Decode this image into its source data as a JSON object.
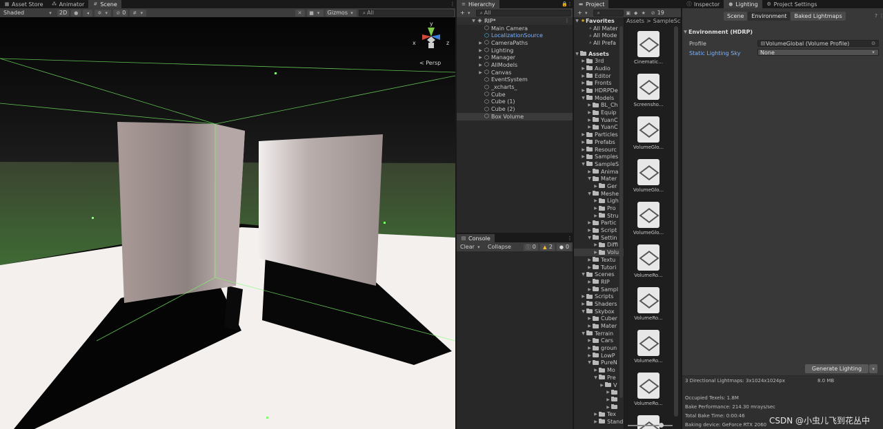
{
  "scene_window": {
    "tabs": [
      {
        "label": "Asset Store",
        "icon": "store-icon"
      },
      {
        "label": "Animator",
        "icon": "animator-icon"
      },
      {
        "label": "Scene",
        "icon": "scene-icon"
      }
    ],
    "shading_mode": "Shaded",
    "mode_2d": "2D",
    "hidden_count": "0",
    "gizmos_label": "Gizmos",
    "search_placeholder": "All",
    "persp_label": "< Persp",
    "axis_labels": {
      "x": "x",
      "y": "y",
      "z": "z"
    }
  },
  "hierarchy": {
    "tab": "Hierarchy",
    "search_placeholder": "All",
    "scene_name": "RIP*",
    "items": [
      {
        "label": "Main Camera",
        "foldable": false
      },
      {
        "label": "LocalizationSource",
        "foldable": false,
        "highlight": true
      },
      {
        "label": "CameraPaths",
        "foldable": true
      },
      {
        "label": "Lighting",
        "foldable": true
      },
      {
        "label": "Manager",
        "foldable": true
      },
      {
        "label": "AllModels",
        "foldable": true
      },
      {
        "label": "Canvas",
        "foldable": true
      },
      {
        "label": "EventSystem",
        "foldable": false
      },
      {
        "label": "_xcharts_",
        "foldable": false
      },
      {
        "label": "Cube",
        "foldable": false
      },
      {
        "label": "Cube (1)",
        "foldable": false
      },
      {
        "label": "Cube (2)",
        "foldable": false
      },
      {
        "label": "Box Volume",
        "foldable": false,
        "selected": true
      }
    ]
  },
  "console": {
    "tab": "Console",
    "clear_label": "Clear",
    "collapse_label": "Collapse",
    "log_count": "0",
    "warning_count": "2",
    "error_count": "0"
  },
  "project": {
    "tab": "Project",
    "hidden_count": "19",
    "favorites_label": "Favorites",
    "favorites": [
      "All Mater",
      "All Mode",
      "All Prefa"
    ],
    "breadcrumb": [
      "Assets",
      "SampleSc"
    ],
    "tree": [
      {
        "label": "Assets",
        "indent": 0,
        "open": true,
        "bold": true
      },
      {
        "label": "3rd",
        "indent": 1
      },
      {
        "label": "Audio",
        "indent": 1
      },
      {
        "label": "Editor",
        "indent": 1
      },
      {
        "label": "Fronts",
        "indent": 1
      },
      {
        "label": "HDRPDe",
        "indent": 1
      },
      {
        "label": "Models",
        "indent": 1,
        "open": true
      },
      {
        "label": "BL_Ch",
        "indent": 2
      },
      {
        "label": "Equip",
        "indent": 2
      },
      {
        "label": "YuanC",
        "indent": 2
      },
      {
        "label": "YuanC",
        "indent": 2
      },
      {
        "label": "Particles",
        "indent": 1
      },
      {
        "label": "Prefabs",
        "indent": 1
      },
      {
        "label": "Resourc",
        "indent": 1
      },
      {
        "label": "Samples",
        "indent": 1
      },
      {
        "label": "SampleS",
        "indent": 1,
        "open": true
      },
      {
        "label": "Anima",
        "indent": 2
      },
      {
        "label": "Mater",
        "indent": 2,
        "open": true
      },
      {
        "label": "Ger",
        "indent": 3
      },
      {
        "label": "Meshe",
        "indent": 2,
        "open": true
      },
      {
        "label": "Ligh",
        "indent": 3
      },
      {
        "label": "Pro",
        "indent": 3
      },
      {
        "label": "Stru",
        "indent": 3
      },
      {
        "label": "Partic",
        "indent": 2
      },
      {
        "label": "Script",
        "indent": 2
      },
      {
        "label": "Settin",
        "indent": 2,
        "open": true
      },
      {
        "label": "Diffi",
        "indent": 3
      },
      {
        "label": "Volu",
        "indent": 3,
        "selected": true
      },
      {
        "label": "Textu",
        "indent": 2
      },
      {
        "label": "Tutori",
        "indent": 2
      },
      {
        "label": "Scenes",
        "indent": 1,
        "open": true
      },
      {
        "label": "RIP",
        "indent": 2
      },
      {
        "label": "Sampl",
        "indent": 2
      },
      {
        "label": "Scripts",
        "indent": 1
      },
      {
        "label": "Shaders",
        "indent": 1
      },
      {
        "label": "Skybox",
        "indent": 1,
        "open": true
      },
      {
        "label": "Cuber",
        "indent": 2
      },
      {
        "label": "Mater",
        "indent": 2
      },
      {
        "label": "Terrain",
        "indent": 1,
        "open": true
      },
      {
        "label": "Cars",
        "indent": 2
      },
      {
        "label": "groun",
        "indent": 2
      },
      {
        "label": "LowP",
        "indent": 2
      },
      {
        "label": "PureN",
        "indent": 2,
        "open": true
      },
      {
        "label": "Mo",
        "indent": 3
      },
      {
        "label": "Pre",
        "indent": 3,
        "open": true
      },
      {
        "label": "V",
        "indent": 4
      },
      {
        "label": "",
        "indent": 5
      },
      {
        "label": "",
        "indent": 5
      },
      {
        "label": "",
        "indent": 5
      },
      {
        "label": "Tex",
        "indent": 3
      },
      {
        "label": "Stand",
        "indent": 3
      }
    ],
    "assets": [
      "Cinematic...",
      "Screensho...",
      "VolumeGlo...",
      "VolumeGlo...",
      "VolumeGlo...",
      "VolumeRo...",
      "VolumeRo...",
      "VolumeRo...",
      "VolumeRo...",
      "VolumeRo..."
    ]
  },
  "lighting": {
    "tabs": [
      {
        "label": "Inspector",
        "icon": "info-icon"
      },
      {
        "label": "Lighting",
        "icon": "bulb-icon"
      },
      {
        "label": "Project Settings",
        "icon": "gear-icon"
      }
    ],
    "subtabs": [
      "Scene",
      "Environment",
      "Baked Lightmaps"
    ],
    "section": "Environment (HDRP)",
    "profile_label": "Profile",
    "profile_value": "VolumeGlobal (Volume Profile)",
    "sky_label": "Static Lighting Sky",
    "sky_value": "None",
    "generate_label": "Generate Lighting",
    "stats": {
      "lightmaps": "3 Directional Lightmaps: 3x1024x1024px",
      "lightmaps_size": "8.0 MB",
      "occupied": "Occupied Texels: 1.8M",
      "performance": "Bake Performance: 214.30 mrays/sec",
      "total_time": "Total Bake Time: 0:00:46",
      "device": "Baking device: GeForce RTX 2060"
    }
  },
  "watermark": "CSDN @小虫儿飞到花丛中",
  "colors": {
    "accent": "#7fb4ff",
    "selected": "#3d5f8a",
    "green_edges": "#7dff6a"
  }
}
